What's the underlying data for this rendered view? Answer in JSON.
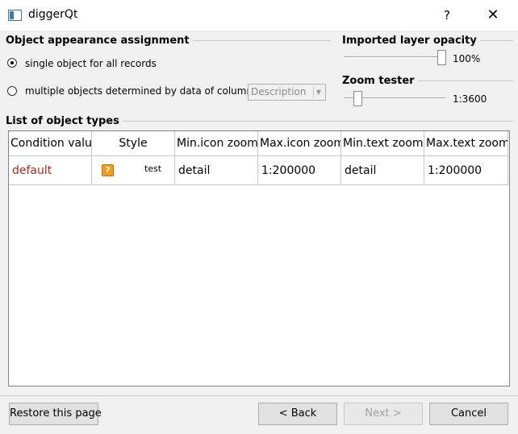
{
  "window": {
    "title": "diggerQt",
    "help_label": "?",
    "close_label": "✕"
  },
  "appearance": {
    "heading": "Object appearance assignment",
    "option_single": "single object for all records",
    "option_multiple": "multiple objects determined by data of column",
    "column_combo_value": "Description",
    "selected_option": "single"
  },
  "opacity": {
    "heading": "Imported layer opacity",
    "value_label": "100%",
    "value": 1.0
  },
  "zoom": {
    "heading": "Zoom tester",
    "value_label": "1:3600",
    "level": 0.1
  },
  "object_types": {
    "heading": "List of object types",
    "columns": [
      "Condition value",
      "Style",
      "Min.icon zoom",
      "Max.icon zoom",
      "Min.text zoom",
      "Max.text zoom"
    ],
    "row": {
      "condition": "default",
      "style_text": "test",
      "min_icon_zoom": "detail",
      "max_icon_zoom": "1:200000",
      "min_text_zoom": "detail",
      "max_text_zoom": "1:200000"
    }
  },
  "buttons": {
    "restore": "Restore this page",
    "back": "< Back",
    "next": "Next >",
    "cancel": "Cancel"
  }
}
